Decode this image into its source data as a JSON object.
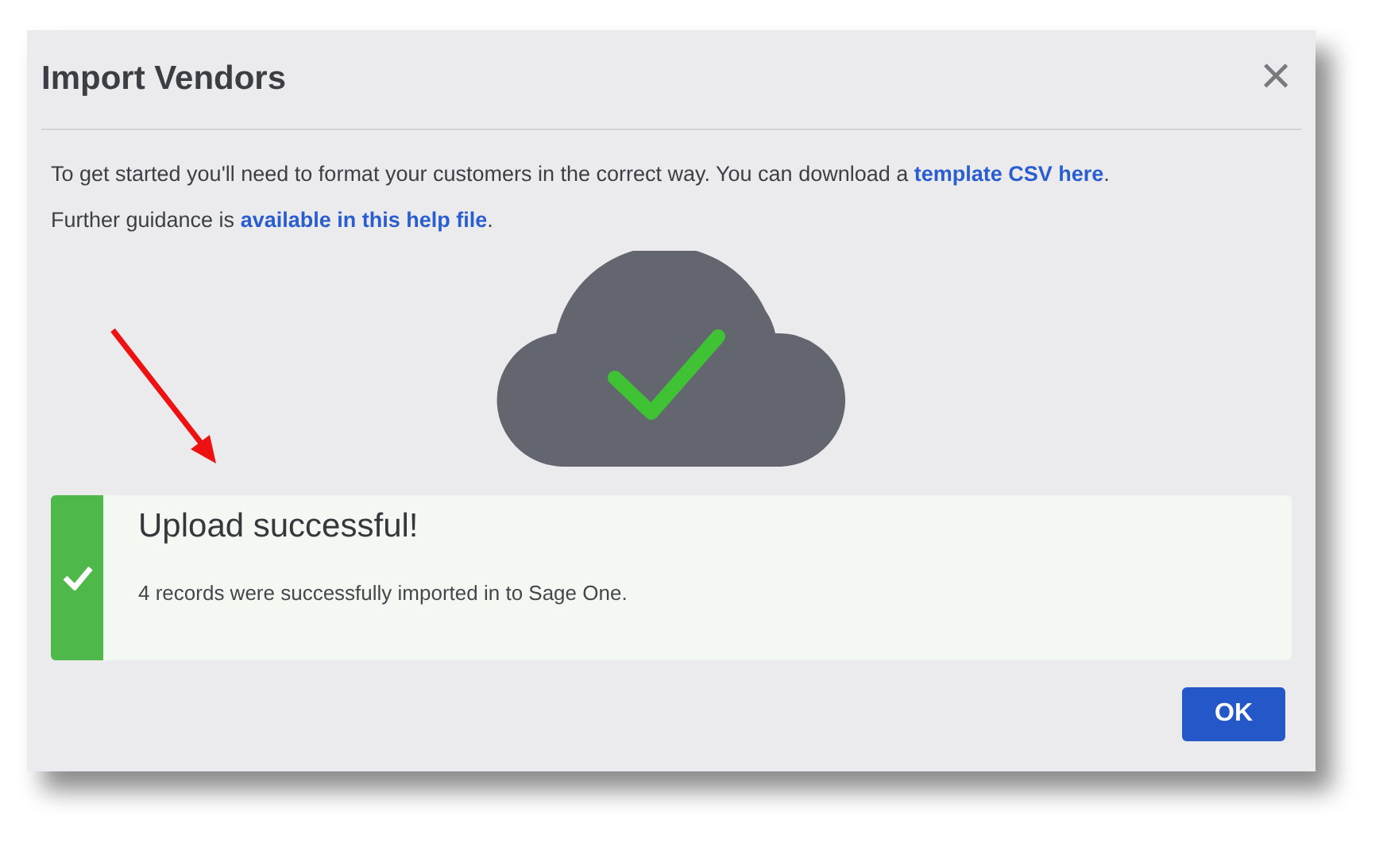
{
  "dialog": {
    "title": "Import Vendors",
    "close": "×"
  },
  "intro": [
    {
      "before": "To get started you'll need to format your customers in the correct way. You can download a ",
      "link": "template CSV here",
      "after": "."
    },
    {
      "before": "Further guidance is ",
      "link": "available in this help file",
      "after": "."
    }
  ],
  "alert": {
    "kind": "success",
    "title": "Upload successful!",
    "message": "4 records were successfully imported in to Sage One."
  },
  "buttons": [
    {
      "label": "OK"
    }
  ]
}
